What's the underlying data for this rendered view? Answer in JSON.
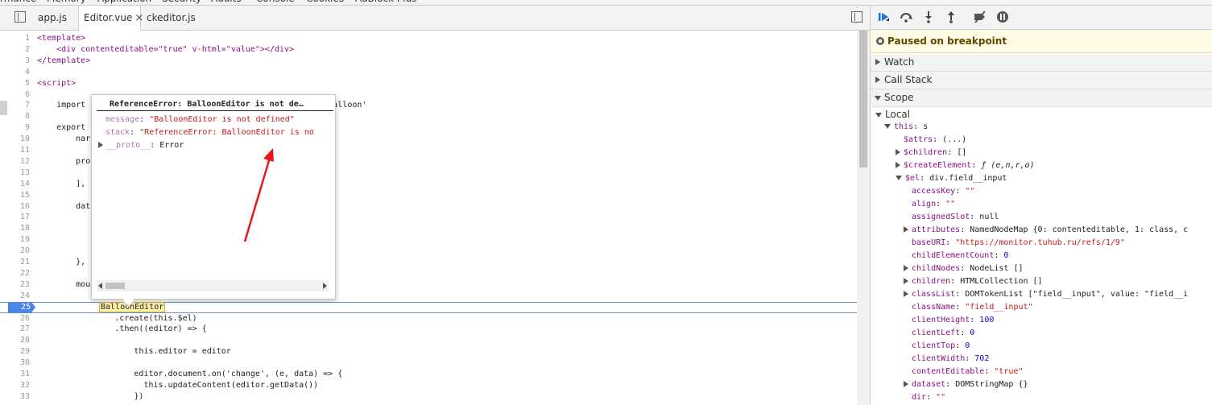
{
  "top_tabs": [
    "rmance",
    "Memory",
    "Application",
    "Security",
    "Audits",
    "Console",
    "Cookies",
    "AdBlock Plus"
  ],
  "file_tabs": [
    {
      "label": "app.js",
      "active": false
    },
    {
      "label": "Editor.vue",
      "active": true,
      "close": "×"
    },
    {
      "label": "ckeditor.js",
      "active": false
    }
  ],
  "code_lines": [
    {
      "n": "1",
      "text": "<template>"
    },
    {
      "n": "2",
      "text": "    <div contenteditable=\"true\" v-html=\"value\"></div>"
    },
    {
      "n": "3",
      "text": "</template>"
    },
    {
      "n": "4",
      "text": ""
    },
    {
      "n": "5",
      "text": "<script>"
    },
    {
      "n": "6",
      "text": ""
    },
    {
      "n": "7",
      "text": "    import                                                 -balloon'"
    },
    {
      "n": "8",
      "text": ""
    },
    {
      "n": "9",
      "text": "    export"
    },
    {
      "n": "10",
      "text": "        nar"
    },
    {
      "n": "11",
      "text": ""
    },
    {
      "n": "12",
      "text": "        pro"
    },
    {
      "n": "13",
      "text": ""
    },
    {
      "n": "14",
      "text": "        ],"
    },
    {
      "n": "15",
      "text": ""
    },
    {
      "n": "16",
      "text": "        dat"
    },
    {
      "n": "17",
      "text": ""
    },
    {
      "n": "18",
      "text": ""
    },
    {
      "n": "19",
      "text": ""
    },
    {
      "n": "20",
      "text": ""
    },
    {
      "n": "21",
      "text": "        },"
    },
    {
      "n": "22",
      "text": ""
    },
    {
      "n": "23",
      "text": "        mou"
    },
    {
      "n": "24",
      "text": ""
    },
    {
      "n": "25",
      "text": ""
    },
    {
      "n": "26",
      "text": "                .create(this.$el)"
    },
    {
      "n": "27",
      "text": "                .then((editor) => {"
    },
    {
      "n": "28",
      "text": ""
    },
    {
      "n": "29",
      "text": "                    this.editor = editor"
    },
    {
      "n": "30",
      "text": ""
    },
    {
      "n": "31",
      "text": "                    editor.document.on('change', (e, data) => {"
    },
    {
      "n": "32",
      "text": "                      this.updateContent(editor.getData())"
    },
    {
      "n": "33",
      "text": "                    })"
    }
  ],
  "exec_line": {
    "n": "25",
    "word": "BalloonEditor"
  },
  "popover": {
    "title": "ReferenceError: BalloonEditor is not de…",
    "props": [
      {
        "key": "message",
        "value": "\"BalloonEditor is not defined\""
      },
      {
        "key": "stack",
        "value": "\"ReferenceError: BalloonEditor is no"
      },
      {
        "key": "__proto__",
        "value": "Error"
      }
    ]
  },
  "debugger": {
    "paused_text": "Paused on breakpoint",
    "sections": [
      "Watch",
      "Call Stack",
      "Scope"
    ],
    "local_label": "Local",
    "scope_rows": [
      {
        "indent": 1,
        "tri": "open",
        "key": "this",
        "value": "s",
        "vclass": "v"
      },
      {
        "indent": 2,
        "tri": "",
        "key": "$attrs",
        "value": "(...)",
        "vclass": "v"
      },
      {
        "indent": 2,
        "tri": "closed",
        "key": "$children",
        "value": "[]",
        "vclass": "v"
      },
      {
        "indent": 2,
        "tri": "closed",
        "key": "$createElement",
        "value": "ƒ (e,n,r,o)",
        "vclass": "vi"
      },
      {
        "indent": 2,
        "tri": "open",
        "key": "$el",
        "value": "div.field__input",
        "vclass": "v"
      },
      {
        "indent": 3,
        "tri": "",
        "key": "accessKey",
        "value": "\"\"",
        "vclass": "vs"
      },
      {
        "indent": 3,
        "tri": "",
        "key": "align",
        "value": "\"\"",
        "vclass": "vs"
      },
      {
        "indent": 3,
        "tri": "",
        "key": "assignedSlot",
        "value": "null",
        "vclass": "v"
      },
      {
        "indent": 3,
        "tri": "closed",
        "key": "attributes",
        "value": "NamedNodeMap {0: contenteditable, 1: class, c",
        "vclass": "v"
      },
      {
        "indent": 3,
        "tri": "",
        "key": "baseURI",
        "value": "\"https://monitor.tuhub.ru/refs/1/9\"",
        "vclass": "vs"
      },
      {
        "indent": 3,
        "tri": "",
        "key": "childElementCount",
        "value": "0",
        "vclass": "vn"
      },
      {
        "indent": 3,
        "tri": "closed",
        "key": "childNodes",
        "value": "NodeList []",
        "vclass": "v"
      },
      {
        "indent": 3,
        "tri": "closed",
        "key": "children",
        "value": "HTMLCollection []",
        "vclass": "v"
      },
      {
        "indent": 3,
        "tri": "closed",
        "key": "classList",
        "value": "DOMTokenList [\"field__input\", value: \"field__i",
        "vclass": "v"
      },
      {
        "indent": 3,
        "tri": "",
        "key": "className",
        "value": "\"field__input\"",
        "vclass": "vs"
      },
      {
        "indent": 3,
        "tri": "",
        "key": "clientHeight",
        "value": "100",
        "vclass": "vn"
      },
      {
        "indent": 3,
        "tri": "",
        "key": "clientLeft",
        "value": "0",
        "vclass": "vn"
      },
      {
        "indent": 3,
        "tri": "",
        "key": "clientTop",
        "value": "0",
        "vclass": "vn"
      },
      {
        "indent": 3,
        "tri": "",
        "key": "clientWidth",
        "value": "702",
        "vclass": "vn"
      },
      {
        "indent": 3,
        "tri": "",
        "key": "contentEditable",
        "value": "\"true\"",
        "vclass": "vs"
      },
      {
        "indent": 3,
        "tri": "closed",
        "key": "dataset",
        "value": "DOMStringMap {}",
        "vclass": "v"
      },
      {
        "indent": 3,
        "tri": "",
        "key": "dir",
        "value": "\"\"",
        "vclass": "vs"
      }
    ]
  },
  "colors": {
    "annotation_arrow": "#e8151b",
    "exec_line": "#4a86e8",
    "paused_bg": "#fffbe5"
  }
}
